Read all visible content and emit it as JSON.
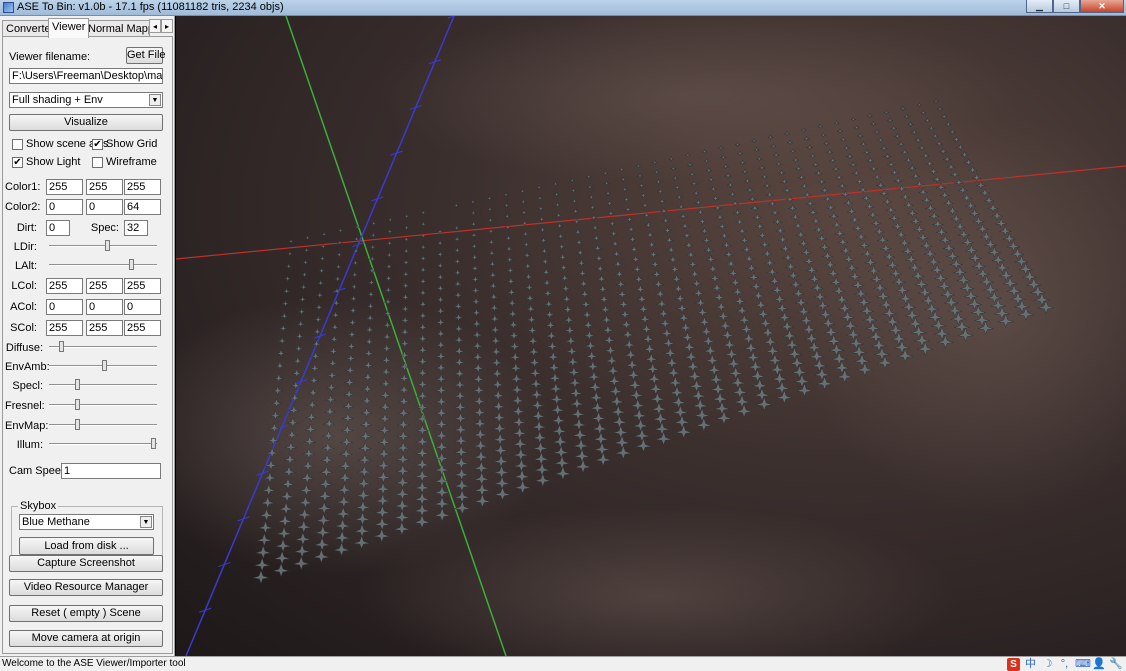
{
  "window": {
    "title": "ASE To Bin: v1.0b - 17.1 fps (11081182 tris, 2234 objs)"
  },
  "tabs": [
    "Converter",
    "Viewer",
    "Normal Mapping"
  ],
  "tab_scroll": {
    "left": "◂",
    "right": "▸"
  },
  "viewer": {
    "filename_label": "Viewer filename:",
    "get_file_label": "Get File",
    "filename_value": "F:\\Users\\Freeman\\Desktop\\max\\ionian",
    "shading_mode": "Full shading + Env",
    "visualize_label": "Visualize",
    "show_scene_axis": {
      "label": "Show scene axis",
      "checked": false
    },
    "show_grid": {
      "label": "Show Grid",
      "checked": true
    },
    "show_light": {
      "label": "Show Light",
      "checked": true
    },
    "wireframe": {
      "label": "Wireframe",
      "checked": false
    },
    "color1": {
      "label": "Color1:",
      "r": "255",
      "g": "255",
      "b": "255"
    },
    "color2": {
      "label": "Color2:",
      "r": "0",
      "g": "0",
      "b": "64"
    },
    "dirt": {
      "label": "Dirt:",
      "value": "0"
    },
    "spec": {
      "label": "Spec:",
      "value": "32"
    },
    "ldir": {
      "label": "LDir:",
      "level": 0.55
    },
    "lalt": {
      "label": "LAlt:",
      "level": 0.78
    },
    "lcol": {
      "label": "LCol:",
      "r": "255",
      "g": "255",
      "b": "255"
    },
    "acol": {
      "label": "ACol:",
      "r": "0",
      "g": "0",
      "b": "0"
    },
    "scol": {
      "label": "SCol:",
      "r": "255",
      "g": "255",
      "b": "255"
    },
    "diffuse": {
      "label": "Diffuse:",
      "level": 0.1
    },
    "envamb": {
      "label": "EnvAmb:",
      "level": 0.52
    },
    "specl": {
      "label": "Specl:",
      "level": 0.25
    },
    "fresnel": {
      "label": "Fresnel:",
      "level": 0.25
    },
    "envmap": {
      "label": "EnvMap:",
      "level": 0.25
    },
    "illum": {
      "label": "Illum:",
      "level": 1.0
    },
    "cam_speed": {
      "label": "Cam Speed:",
      "value": "1"
    },
    "skybox": {
      "label": "Skybox",
      "selected": "Blue Methane",
      "load_label": "Load from disk ..."
    },
    "capture_label": "Capture Screenshot",
    "video_label": "Video Resource Manager",
    "reset_label": "Reset ( empty ) Scene",
    "move_camera_label": "Move camera at origin"
  },
  "status": {
    "text": "Welcome to the ASE Viewer/Importer tool"
  },
  "tray_icons": [
    "sogou-icon",
    "chinese-mode-icon",
    "moon-icon",
    "punctuation-icon",
    "keyboard-icon",
    "user-icon",
    "wrench-icon"
  ],
  "tray_glyphs": [
    "S",
    "中",
    "☽",
    "°,",
    "⌨",
    "👤",
    "🔧"
  ],
  "scene": {
    "axis_colors": {
      "x": "#c0302a",
      "y": "#3ab03a",
      "z": "#3a3ad0"
    },
    "model_color": "#6b7478"
  }
}
